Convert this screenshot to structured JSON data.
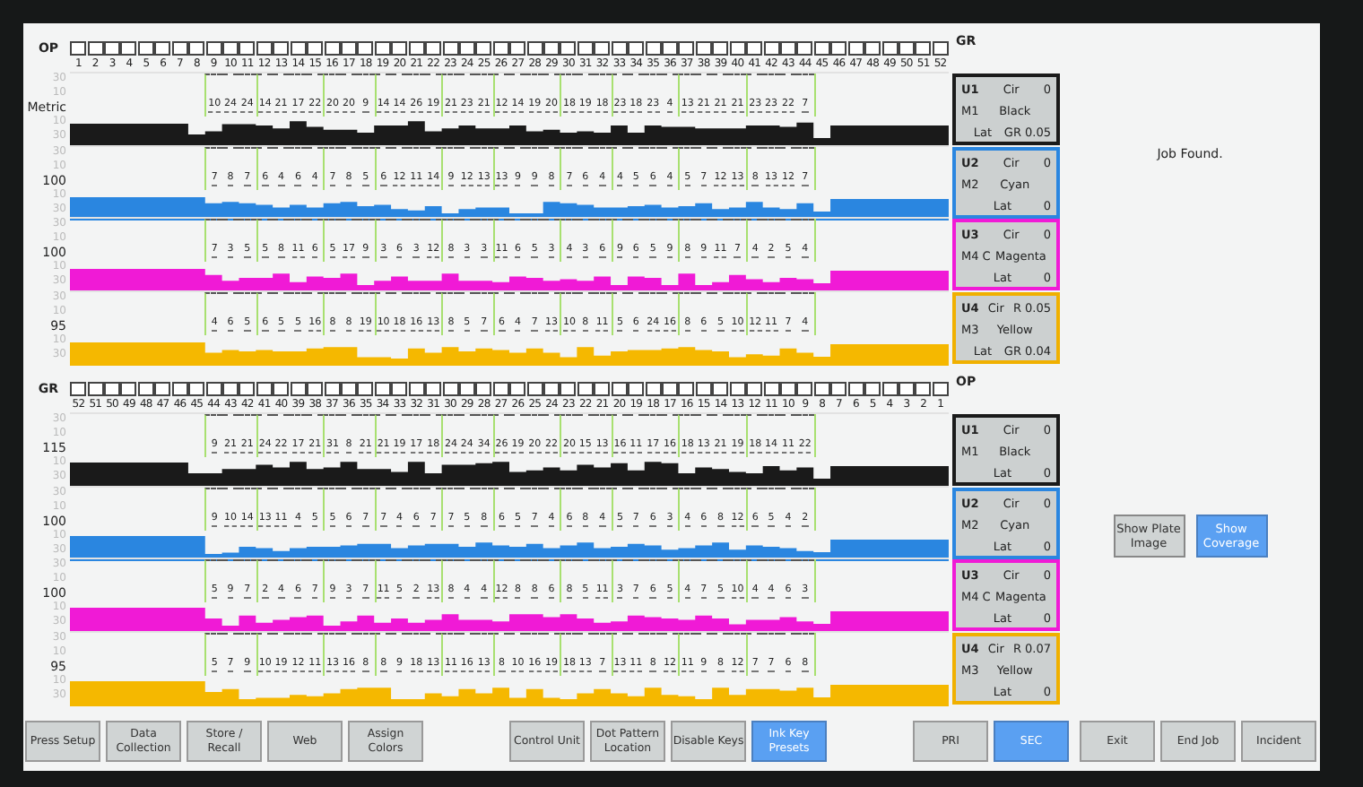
{
  "halves": [
    {
      "side_label": "OP",
      "units_label": "GR",
      "keys": [
        "1",
        "2",
        "3",
        "4",
        "5",
        "6",
        "7",
        "8",
        "9",
        "10",
        "11",
        "12",
        "13",
        "14",
        "15",
        "16",
        "17",
        "18",
        "19",
        "20",
        "21",
        "22",
        "23",
        "24",
        "25",
        "26",
        "27",
        "28",
        "29",
        "30",
        "31",
        "32",
        "33",
        "34",
        "35",
        "36",
        "37",
        "38",
        "39",
        "40",
        "41",
        "42",
        "43",
        "44",
        "45",
        "46",
        "47",
        "48",
        "49",
        "50",
        "51",
        "52"
      ],
      "strips": [
        {
          "color": "#1a1a1a",
          "ticks_above": [
            "30",
            "10"
          ],
          "label": "Metric",
          "ticks_below": [
            "10",
            "30"
          ],
          "values": [
            "10",
            "24",
            "24",
            "14",
            "21",
            "17",
            "22",
            "20",
            "20",
            "9",
            "14",
            "14",
            "26",
            "19",
            "21",
            "23",
            "21",
            "12",
            "14",
            "19",
            "20",
            "18",
            "19",
            "18",
            "23",
            "18",
            "23",
            "4",
            "13",
            "21",
            "21",
            "21",
            "23",
            "23",
            "22",
            "7"
          ]
        },
        {
          "color": "#2a86e0",
          "ticks_above": [
            "30",
            "10"
          ],
          "label": "100",
          "ticks_below": [
            "10",
            "30"
          ],
          "values": [
            "7",
            "8",
            "7",
            "6",
            "4",
            "6",
            "4",
            "7",
            "8",
            "5",
            "6",
            "12",
            "11",
            "14",
            "9",
            "12",
            "13",
            "13",
            "9",
            "9",
            "8",
            "7",
            "6",
            "4",
            "4",
            "5",
            "6",
            "4",
            "5",
            "7",
            "12",
            "13",
            "8",
            "13",
            "12",
            "7"
          ]
        },
        {
          "color": "#f01ad6",
          "ticks_above": [
            "30",
            "10"
          ],
          "label": "100",
          "ticks_below": [
            "10",
            "30"
          ],
          "values": [
            "7",
            "3",
            "5",
            "5",
            "8",
            "11",
            "6",
            "5",
            "17",
            "9",
            "3",
            "6",
            "3",
            "12",
            "8",
            "3",
            "3",
            "11",
            "6",
            "5",
            "3",
            "4",
            "3",
            "6",
            "9",
            "6",
            "5",
            "9",
            "8",
            "9",
            "11",
            "7",
            "4",
            "2",
            "5",
            "4"
          ]
        },
        {
          "color": "#f5b800",
          "ticks_above": [
            "30",
            "10"
          ],
          "label": "95",
          "ticks_below": [
            "10",
            "30"
          ],
          "values": [
            "4",
            "6",
            "5",
            "6",
            "5",
            "5",
            "16",
            "8",
            "8",
            "19",
            "10",
            "18",
            "16",
            "13",
            "8",
            "5",
            "7",
            "6",
            "4",
            "7",
            "13",
            "10",
            "8",
            "11",
            "5",
            "6",
            "24",
            "16",
            "8",
            "6",
            "5",
            "10",
            "12",
            "11",
            "7",
            "4"
          ]
        }
      ],
      "units": [
        {
          "unit": "U1",
          "cir_label": "Cir",
          "cir": "0",
          "motor": "M1",
          "ink": "Black",
          "lat_label": "Lat",
          "lat": "GR 0.05",
          "color": "#1a1a1a"
        },
        {
          "unit": "U2",
          "cir_label": "Cir",
          "cir": "0",
          "motor": "M2",
          "ink": "Cyan",
          "lat_label": "Lat",
          "lat": "0",
          "color": "#2a86e0"
        },
        {
          "unit": "U3",
          "cir_label": "Cir",
          "cir": "0",
          "motor": "M4 C",
          "ink": "Magenta",
          "lat_label": "Lat",
          "lat": "0",
          "color": "#f01ad6"
        },
        {
          "unit": "U4",
          "cir_label": "Cir",
          "cir": "R 0.05",
          "motor": "M3",
          "ink": "Yellow",
          "lat_label": "Lat",
          "lat": "GR 0.04",
          "color": "#f0b000"
        }
      ]
    },
    {
      "side_label": "GR",
      "units_label": "OP",
      "keys": [
        "52",
        "51",
        "50",
        "49",
        "48",
        "47",
        "46",
        "45",
        "44",
        "43",
        "42",
        "41",
        "40",
        "39",
        "38",
        "37",
        "36",
        "35",
        "34",
        "33",
        "32",
        "31",
        "30",
        "29",
        "28",
        "27",
        "26",
        "25",
        "24",
        "23",
        "22",
        "21",
        "20",
        "19",
        "18",
        "17",
        "16",
        "15",
        "14",
        "13",
        "12",
        "11",
        "10",
        "9",
        "8",
        "7",
        "6",
        "5",
        "4",
        "3",
        "2",
        "1"
      ],
      "strips": [
        {
          "color": "#1a1a1a",
          "ticks_above": [
            "30",
            "10"
          ],
          "label": "115",
          "ticks_below": [
            "10",
            "30"
          ],
          "values": [
            "9",
            "21",
            "21",
            "24",
            "22",
            "17",
            "21",
            "31",
            "8",
            "21",
            "21",
            "19",
            "17",
            "18",
            "24",
            "24",
            "34",
            "26",
            "19",
            "20",
            "22",
            "20",
            "15",
            "13",
            "16",
            "11",
            "17",
            "16",
            "18",
            "13",
            "21",
            "19",
            "18",
            "14",
            "11",
            "22"
          ]
        },
        {
          "color": "#2a86e0",
          "ticks_above": [
            "30",
            "10"
          ],
          "label": "100",
          "ticks_below": [
            "10",
            "30"
          ],
          "values": [
            "9",
            "10",
            "14",
            "13",
            "11",
            "4",
            "5",
            "5",
            "6",
            "7",
            "7",
            "4",
            "6",
            "7",
            "7",
            "5",
            "8",
            "6",
            "5",
            "7",
            "4",
            "6",
            "8",
            "4",
            "5",
            "7",
            "6",
            "3",
            "4",
            "6",
            "8",
            "12",
            "6",
            "5",
            "4",
            "2"
          ]
        },
        {
          "color": "#f01ad6",
          "ticks_above": [
            "30",
            "10"
          ],
          "label": "100",
          "ticks_below": [
            "10",
            "30"
          ],
          "values": [
            "5",
            "9",
            "7",
            "2",
            "4",
            "6",
            "7",
            "9",
            "3",
            "7",
            "11",
            "5",
            "2",
            "13",
            "8",
            "4",
            "4",
            "12",
            "8",
            "8",
            "6",
            "8",
            "5",
            "11",
            "3",
            "7",
            "6",
            "5",
            "4",
            "7",
            "5",
            "10",
            "4",
            "4",
            "6",
            "3"
          ]
        },
        {
          "color": "#f5b800",
          "ticks_above": [
            "30",
            "10"
          ],
          "label": "95",
          "ticks_below": [
            "10",
            "30"
          ],
          "values": [
            "5",
            "7",
            "9",
            "10",
            "19",
            "12",
            "11",
            "13",
            "16",
            "8",
            "8",
            "9",
            "18",
            "13",
            "11",
            "16",
            "13",
            "8",
            "10",
            "16",
            "19",
            "18",
            "13",
            "7",
            "13",
            "11",
            "8",
            "12",
            "11",
            "9",
            "8",
            "12",
            "7",
            "7",
            "6",
            "8"
          ]
        }
      ],
      "units": [
        {
          "unit": "U1",
          "cir_label": "Cir",
          "cir": "0",
          "motor": "M1",
          "ink": "Black",
          "lat_label": "Lat",
          "lat": "0",
          "color": "#1a1a1a"
        },
        {
          "unit": "U2",
          "cir_label": "Cir",
          "cir": "0",
          "motor": "M2",
          "ink": "Cyan",
          "lat_label": "Lat",
          "lat": "0",
          "color": "#2a86e0"
        },
        {
          "unit": "U3",
          "cir_label": "Cir",
          "cir": "0",
          "motor": "M4 C",
          "ink": "Magenta",
          "lat_label": "Lat",
          "lat": "0",
          "color": "#f01ad6"
        },
        {
          "unit": "U4",
          "cir_label": "Cir",
          "cir": "R 0.07",
          "motor": "M3",
          "ink": "Yellow",
          "lat_label": "Lat",
          "lat": "0",
          "color": "#f0b000"
        }
      ]
    }
  ],
  "status": "Job Found.",
  "view_buttons": [
    {
      "label": "Show Plate Image",
      "selected": false
    },
    {
      "label": "Show Coverage",
      "selected": true
    }
  ],
  "toolbar_groups": [
    [
      {
        "label": "Press Setup",
        "selected": false
      },
      {
        "label": "Data Collection",
        "selected": false
      },
      {
        "label": "Store / Recall",
        "selected": false
      },
      {
        "label": "Web",
        "selected": false
      },
      {
        "label": "Assign Colors",
        "selected": false
      }
    ],
    [
      {
        "label": "Control Unit",
        "selected": false
      },
      {
        "label": "Dot Pattern Location",
        "selected": false
      },
      {
        "label": "Disable Keys",
        "selected": false
      },
      {
        "label": "Ink Key Presets",
        "selected": true
      }
    ],
    [
      {
        "label": "PRI",
        "selected": false
      },
      {
        "label": "SEC",
        "selected": true
      }
    ],
    [
      {
        "label": "Exit",
        "selected": false
      },
      {
        "label": "End Job",
        "selected": false
      },
      {
        "label": "Incident",
        "selected": false
      }
    ]
  ]
}
